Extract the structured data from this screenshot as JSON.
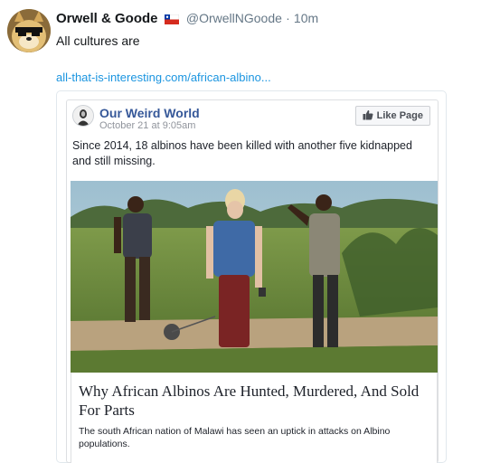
{
  "tweet": {
    "display_name": "Orwell & Goode",
    "handle": "@OrwellNGoode",
    "separator": "·",
    "time": "10m",
    "text": "All cultures are",
    "link": "all-that-is-interesting.com/african-albino..."
  },
  "embed": {
    "page_name": "Our Weird World",
    "date": "October 21 at 9:05am",
    "like_button": "Like Page",
    "post_text": "Since 2014, 18 albinos have been killed with another five kidnapped and still missing.",
    "article_title": "Why African Albinos Are Hunted, Murdered, And Sold For Parts",
    "article_description": "The south African nation of Malawi has seen an uptick in attacks on Albino populations."
  },
  "icons": {
    "flag": "chile-flag-icon",
    "like": "thumbs-up-icon"
  },
  "colors": {
    "link_blue": "#1b95e0",
    "page_name_blue": "#365899",
    "muted_gray": "#657786"
  }
}
